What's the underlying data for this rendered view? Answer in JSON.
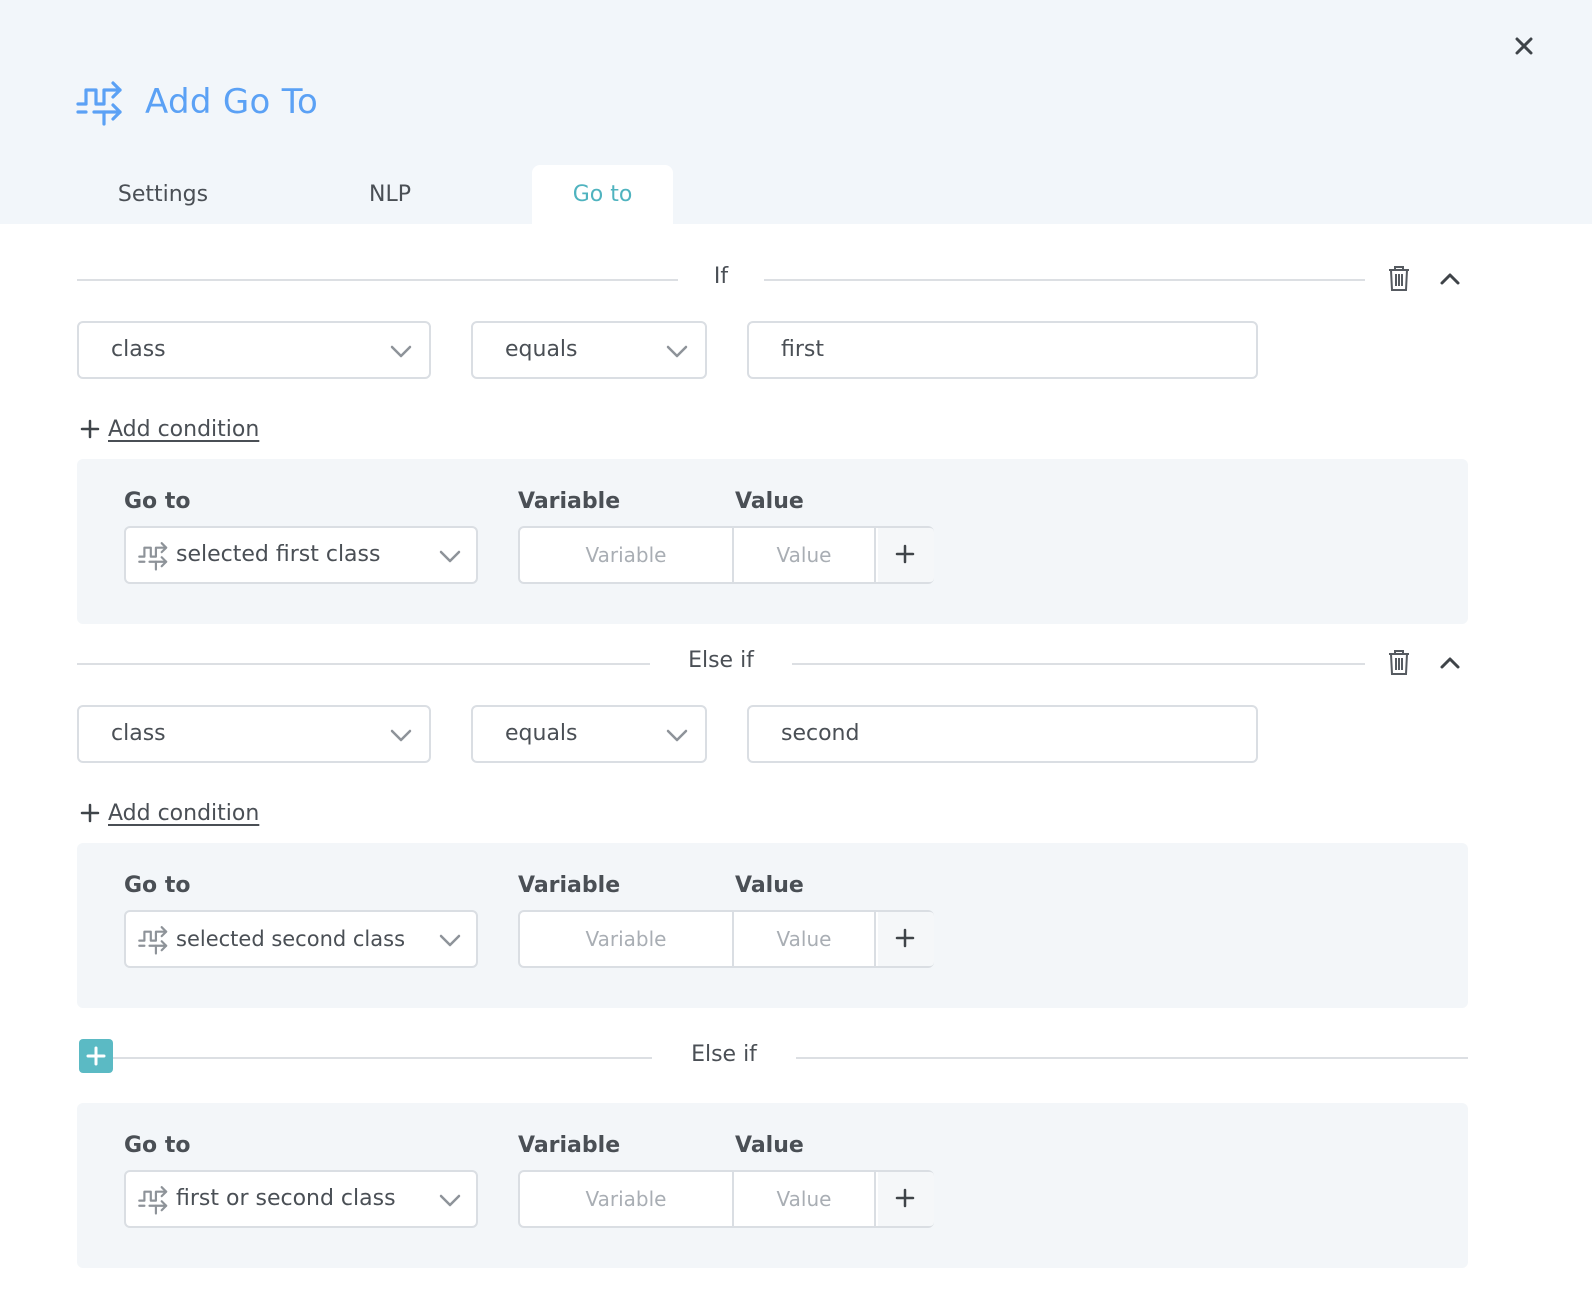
{
  "dialog": {
    "title": "Add Go To",
    "title_icon": "goto-arrows-icon",
    "close_icon": "close-icon",
    "accent_color": "#5ba1f5",
    "teal_color": "#4fb3bf"
  },
  "tabs": [
    {
      "label": "Settings",
      "active": false
    },
    {
      "label": "NLP",
      "active": false
    },
    {
      "label": "Go to",
      "active": true
    }
  ],
  "blocks": [
    {
      "section_label": "If",
      "condition": {
        "field": "class",
        "operator": "equals",
        "value": "first"
      },
      "add_condition_label": "Add condition",
      "goto": {
        "goto_label": "Go to",
        "variable_label": "Variable",
        "value_label": "Value",
        "target": "selected first class",
        "variable_placeholder": "Variable",
        "value_placeholder": "Value"
      }
    },
    {
      "section_label": "Else if",
      "condition": {
        "field": "class",
        "operator": "equals",
        "value": "second"
      },
      "add_condition_label": "Add condition",
      "goto": {
        "goto_label": "Go to",
        "variable_label": "Variable",
        "value_label": "Value",
        "target": "selected second class",
        "variable_placeholder": "Variable",
        "value_placeholder": "Value"
      }
    }
  ],
  "else_block": {
    "section_label": "Else if",
    "goto": {
      "goto_label": "Go to",
      "variable_label": "Variable",
      "value_label": "Value",
      "target": "first or second class",
      "variable_placeholder": "Variable",
      "value_placeholder": "Value"
    }
  }
}
